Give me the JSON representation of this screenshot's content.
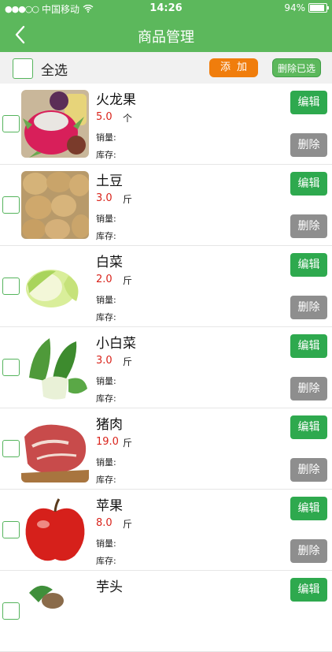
{
  "status_bar": {
    "carrier": "中国移动",
    "time": "14:26",
    "battery": "94%"
  },
  "nav": {
    "title": "商品管理",
    "back_icon": "chevron-left-icon"
  },
  "toolbar": {
    "select_all_label": "全选",
    "add_label": "添加",
    "delete_selected_label": "删除已选"
  },
  "list_labels": {
    "sales": "销量:",
    "stock": "库存:",
    "edit": "编辑",
    "delete": "删除"
  },
  "products": [
    {
      "name": "火龙果",
      "price": "5.0",
      "unit": "个",
      "image": "dragon-fruit"
    },
    {
      "name": "土豆",
      "price": "3.0",
      "unit": "斤",
      "image": "potatoes"
    },
    {
      "name": "白菜",
      "price": "2.0",
      "unit": "斤",
      "image": "napa-cabbage"
    },
    {
      "name": "小白菜",
      "price": "3.0",
      "unit": "斤",
      "image": "bok-choy"
    },
    {
      "name": "猪肉",
      "price": "19.0",
      "unit": "斤",
      "image": "pork"
    },
    {
      "name": "苹果",
      "price": "8.0",
      "unit": "斤",
      "image": "apple"
    },
    {
      "name": "芋头",
      "price": "",
      "unit": "",
      "image": "taro"
    }
  ],
  "colors": {
    "brand_green": "#5cb85c",
    "edit_green": "#2ea94e",
    "add_orange": "#f07d0c",
    "delete_gray": "#8e8e8e",
    "price_red": "#d9241c"
  }
}
